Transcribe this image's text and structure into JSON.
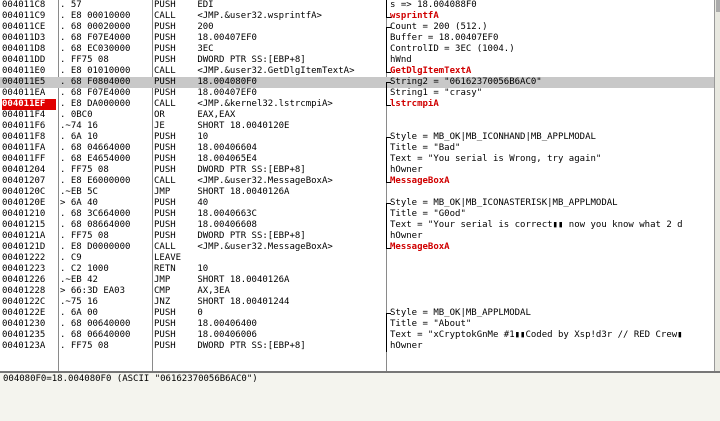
{
  "rows": [
    {
      "addr": "004011C8",
      "hex": ". 57",
      "asm": "PUSH    EDI",
      "cmt": "s => 18.004088F0",
      "cmt_red": false,
      "br": "|"
    },
    {
      "addr": "004011C9",
      "hex": ". E8 00010000",
      "asm": "CALL    <JMP.&user32.wsprintfA>",
      "cmt": "wsprintfA",
      "cmt_red": true,
      "br": "L"
    },
    {
      "addr": "004011CE",
      "hex": ". 68 00020000",
      "asm": "PUSH    200",
      "cmt": "Count = 200 (512.)",
      "cmt_red": false,
      "br": "r"
    },
    {
      "addr": "004011D3",
      "hex": ". 68 F07E4000",
      "asm": "PUSH    18.00407EF0",
      "cmt": "Buffer = 18.00407EF0",
      "cmt_red": false,
      "br": "|"
    },
    {
      "addr": "004011D8",
      "hex": ". 68 EC030000",
      "asm": "PUSH    3EC",
      "cmt": "ControlID = 3EC (1004.)",
      "cmt_red": false,
      "br": "|"
    },
    {
      "addr": "004011DD",
      "hex": ". FF75 08",
      "asm": "PUSH    DWORD PTR SS:[EBP+8]",
      "cmt": "hWnd",
      "cmt_red": false,
      "br": "|"
    },
    {
      "addr": "004011E0",
      "hex": ". E8 01010000",
      "asm": "CALL    <JMP.&user32.GetDlgItemTextA>",
      "cmt": "GetDlgItemTextA",
      "cmt_red": true,
      "br": "L"
    },
    {
      "addr": "004011E5",
      "hex": ". 68 F0804000",
      "asm": "PUSH    18.004080F0",
      "cmt": "String2 = \"06162370056B6AC0\"",
      "cmt_red": false,
      "br": "r"
    },
    {
      "addr": "004011EA",
      "hex": ". 68 F07E4000",
      "asm": "PUSH    18.00407EF0",
      "cmt": "String1 = \"crasy\"",
      "cmt_red": false,
      "br": "|"
    },
    {
      "addr": "004011EF",
      "hex": ". E8 DA000000",
      "asm": "CALL    <JMP.&kernel32.lstrcmpiA>",
      "cmt": "lstrcmpiA",
      "cmt_red": true,
      "br": "L"
    },
    {
      "addr": "004011F4",
      "hex": ". 0BC0",
      "asm": "OR      EAX,EAX",
      "cmt": "",
      "cmt_red": false,
      "br": ""
    },
    {
      "addr": "004011F6",
      "hex": ".~74 16",
      "asm": "JE      SHORT 18.0040120E",
      "cmt": "",
      "cmt_red": false,
      "br": ""
    },
    {
      "addr": "004011F8",
      "hex": ". 6A 10",
      "asm": "PUSH    10",
      "cmt": "Style = MB_OK|MB_ICONHAND|MB_APPLMODAL",
      "cmt_red": false,
      "br": "r"
    },
    {
      "addr": "004011FA",
      "hex": ". 68 04664000",
      "asm": "PUSH    18.00406604",
      "cmt": "Title = \"Bad\"",
      "cmt_red": false,
      "br": "|"
    },
    {
      "addr": "004011FF",
      "hex": ". 68 E4654000",
      "asm": "PUSH    18.004065E4",
      "cmt": "Text = \"You serial is Wrong, try again\"",
      "cmt_red": false,
      "br": "|"
    },
    {
      "addr": "00401204",
      "hex": ". FF75 08",
      "asm": "PUSH    DWORD PTR SS:[EBP+8]",
      "cmt": "hOwner",
      "cmt_red": false,
      "br": "|"
    },
    {
      "addr": "00401207",
      "hex": ". E8 E6000000",
      "asm": "CALL    <JMP.&user32.MessageBoxA>",
      "cmt": "MessageBoxA",
      "cmt_red": true,
      "br": "L"
    },
    {
      "addr": "0040120C",
      "hex": ".~EB 5C",
      "asm": "JMP     SHORT 18.0040126A",
      "cmt": "",
      "cmt_red": false,
      "br": ""
    },
    {
      "addr": "0040120E",
      "hex": "> 6A 40",
      "asm": "PUSH    40",
      "cmt": "Style = MB_OK|MB_ICONASTERISK|MB_APPLMODAL",
      "cmt_red": false,
      "br": "r"
    },
    {
      "addr": "00401210",
      "hex": ". 68 3C664000",
      "asm": "PUSH    18.0040663C",
      "cmt": "Title = \"G0od\"",
      "cmt_red": false,
      "br": "|"
    },
    {
      "addr": "00401215",
      "hex": ". 68 08664000",
      "asm": "PUSH    18.00406608",
      "cmt": "Text = \"Your serial is correct▮▮ now you know what 2 d",
      "cmt_red": false,
      "br": "|"
    },
    {
      "addr": "0040121A",
      "hex": ". FF75 08",
      "asm": "PUSH    DWORD PTR SS:[EBP+8]",
      "cmt": "hOwner",
      "cmt_red": false,
      "br": "|"
    },
    {
      "addr": "0040121D",
      "hex": ". E8 D0000000",
      "asm": "CALL    <JMP.&user32.MessageBoxA>",
      "cmt": "MessageBoxA",
      "cmt_red": true,
      "br": "L"
    },
    {
      "addr": "00401222",
      "hex": ". C9",
      "asm": "LEAVE",
      "cmt": "",
      "cmt_red": false,
      "br": ""
    },
    {
      "addr": "00401223",
      "hex": ". C2 1000",
      "asm": "RETN    10",
      "cmt": "",
      "cmt_red": false,
      "br": ""
    },
    {
      "addr": "00401226",
      "hex": ".~EB 42",
      "asm": "JMP     SHORT 18.0040126A",
      "cmt": "",
      "cmt_red": false,
      "br": ""
    },
    {
      "addr": "00401228",
      "hex": "> 66:3D EA03",
      "asm": "CMP     AX,3EA",
      "cmt": "",
      "cmt_red": false,
      "br": ""
    },
    {
      "addr": "0040122C",
      "hex": ".~75 16",
      "asm": "JNZ     SHORT 18.00401244",
      "cmt": "",
      "cmt_red": false,
      "br": ""
    },
    {
      "addr": "0040122E",
      "hex": ". 6A 00",
      "asm": "PUSH    0",
      "cmt": "Style = MB_OK|MB_APPLMODAL",
      "cmt_red": false,
      "br": "r"
    },
    {
      "addr": "00401230",
      "hex": ". 68 00640000",
      "asm": "PUSH    18.00406400",
      "cmt": "Title = \"About\"",
      "cmt_red": false,
      "br": "|"
    },
    {
      "addr": "00401235",
      "hex": ". 68 06640000",
      "asm": "PUSH    18.00406006",
      "cmt": "Text = \"xCryptokGnMe #1▮▮Coded by Xsp!d3r // RED Crew▮",
      "cmt_red": false,
      "br": "|"
    },
    {
      "addr": "0040123A",
      "hex": ". FF75 08",
      "asm": "PUSH    DWORD PTR SS:[EBP+8]",
      "cmt": "hOwner",
      "cmt_red": false,
      "br": "|"
    }
  ],
  "highlight_index": 7,
  "current_index": 9,
  "info_text": "004080F0=18.004080F0 (ASCII \"06162370056B6AC0\")",
  "colors": {
    "highlight": "#c8c8c8",
    "current": "#e00000",
    "api_red": "#d00000"
  }
}
